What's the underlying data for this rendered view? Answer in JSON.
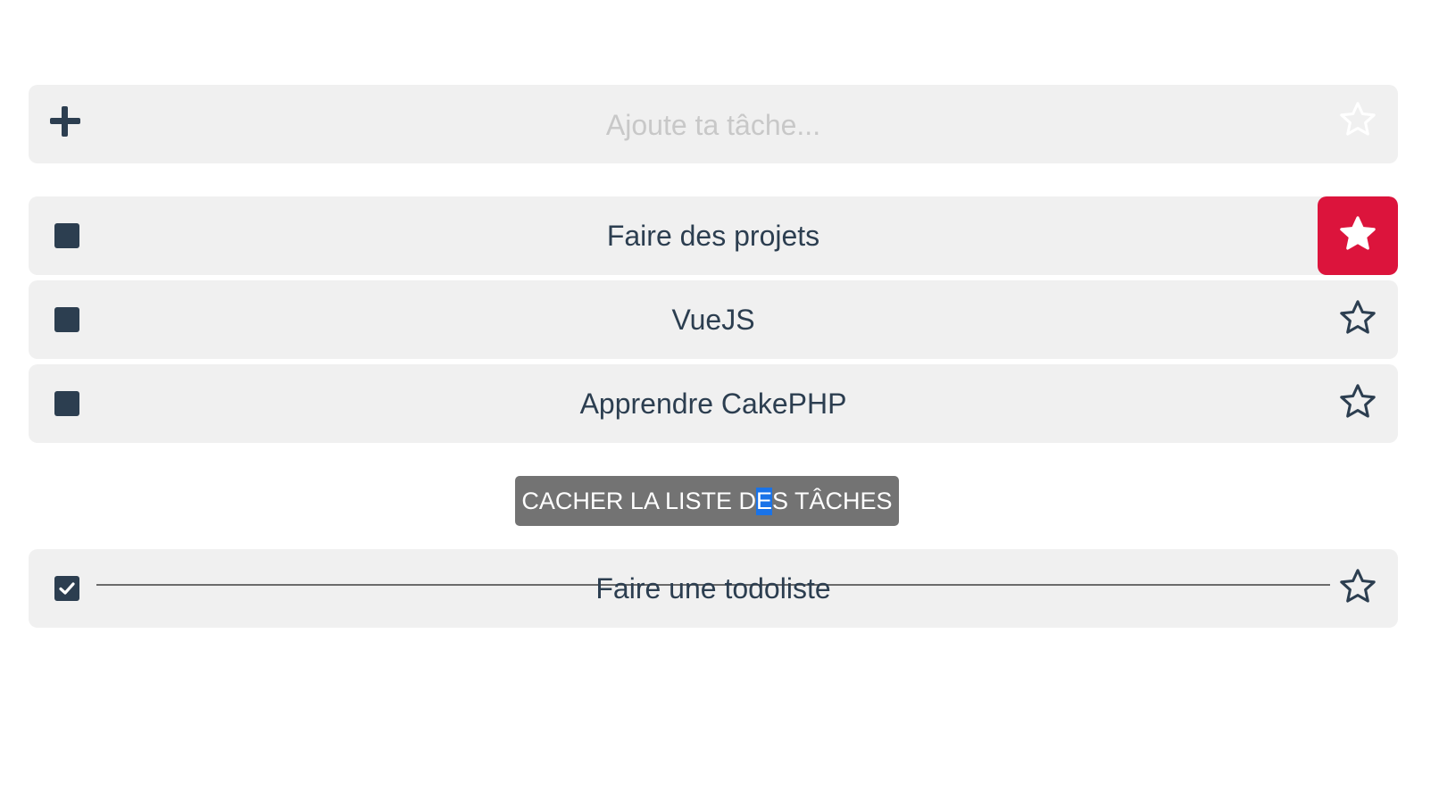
{
  "add_task": {
    "placeholder": "Ajoute ta tâche...",
    "add_icon": "plus-icon",
    "star_icon": "star-outline-icon"
  },
  "tasks": [
    {
      "label": "Faire des projets",
      "done": false,
      "favorite": true
    },
    {
      "label": "VueJS",
      "done": false,
      "favorite": false
    },
    {
      "label": "Apprendre CakePHP",
      "done": false,
      "favorite": false
    }
  ],
  "toggle_button": {
    "label_before": "CACHER LA LISTE D",
    "label_selected": "E",
    "label_after": "S TÂCHES"
  },
  "done_tasks": [
    {
      "label": "Faire une todoliste",
      "done": true,
      "favorite": false
    }
  ],
  "colors": {
    "row_background": "#f0f0f0",
    "text": "#2c3e50",
    "favorite_accent": "#dc143c",
    "button_background": "#737373",
    "placeholder": "#c8c8c8",
    "selection": "#1a73e8"
  }
}
